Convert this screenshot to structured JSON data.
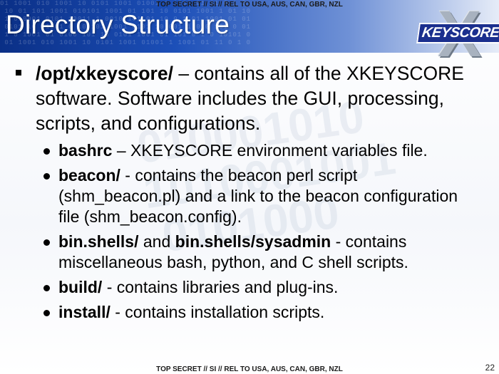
{
  "classification": "TOP SECRET // SI // REL TO USA, AUS, CAN, GBR, NZL",
  "title": "Directory Structure",
  "logo": {
    "text": "KEYSCORE",
    "mark": "X"
  },
  "main_bullet": {
    "bold": "/opt/xkeyscore/",
    "text": " – contains all of the XKEYSCORE software.  Software includes the GUI, processing, scripts, and configurations."
  },
  "sub_bullets": [
    {
      "bold": "bashrc",
      "text": " – XKEYSCORE environment variables file."
    },
    {
      "bold": "beacon/",
      "text": " - contains the beacon perl script (shm_beacon.pl) and a link to the beacon configuration file (shm_beacon.config)."
    },
    {
      "bold": "bin.shells/",
      "mid": " and ",
      "bold2": "bin.shells/sysadmin",
      "text": " - contains miscellaneous bash, python, and C shell scripts."
    },
    {
      "bold": "build/",
      "text": " - contains libraries and plug-ins."
    },
    {
      "bold": "install/",
      "text": " - contains installation scripts."
    }
  ],
  "page_number": "22"
}
